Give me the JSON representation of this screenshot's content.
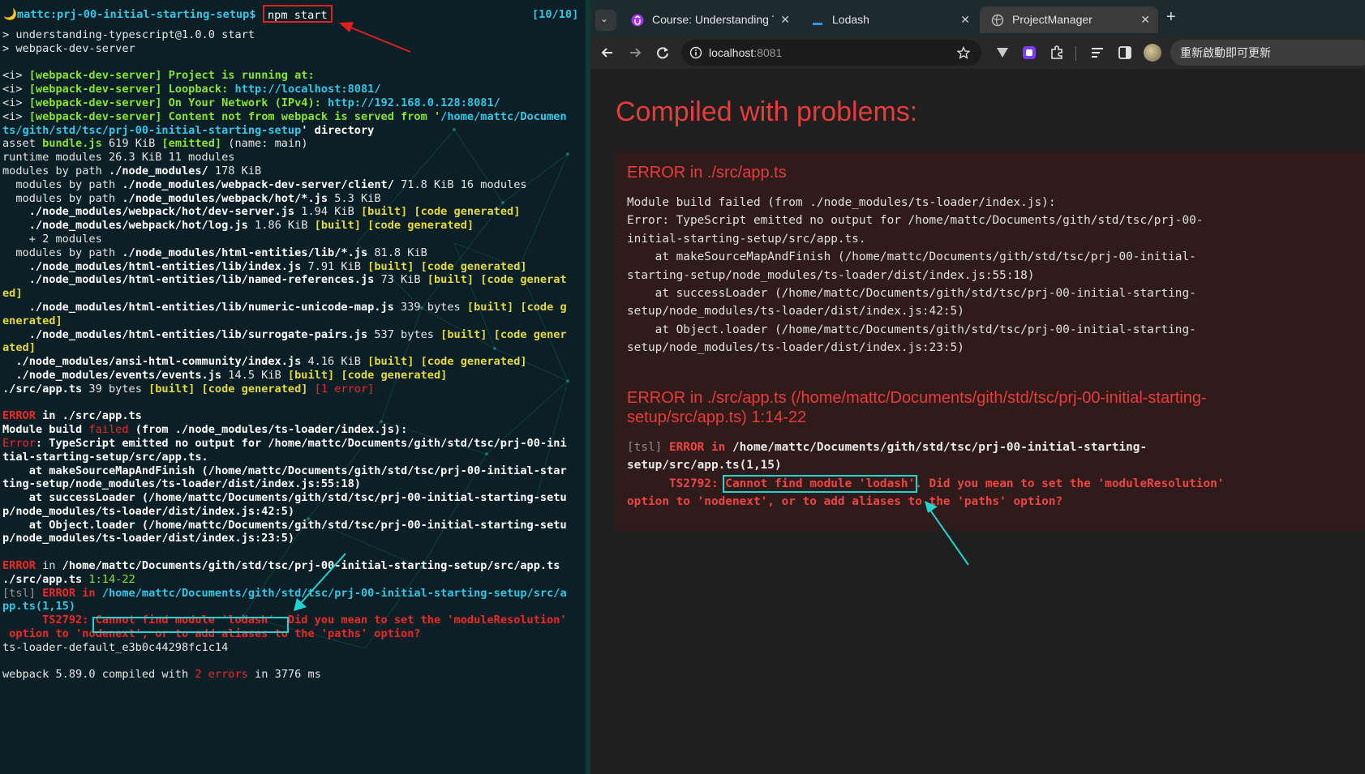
{
  "terminal": {
    "prompt_host": "🌙mattc:prj-00-initial-starting-setup$",
    "command": "npm start",
    "counter": "[10/10]",
    "lines": [
      [
        [
          "> understanding-typescript@1.0.0 start",
          "w"
        ]
      ],
      [
        [
          "> webpack-dev-server",
          "w"
        ]
      ],
      [
        [
          "",
          ""
        ]
      ],
      [
        [
          "<i> ",
          "w"
        ],
        [
          "[webpack-dev-server] Project is running at:",
          "g"
        ]
      ],
      [
        [
          "<i> ",
          "w"
        ],
        [
          "[webpack-dev-server] Loopback: ",
          "g"
        ],
        [
          "http://localhost:8081/",
          "c"
        ]
      ],
      [
        [
          "<i> ",
          "w"
        ],
        [
          "[webpack-dev-server] On Your Network (IPv4): ",
          "g"
        ],
        [
          "http://192.168.0.128:8081/",
          "c"
        ]
      ],
      [
        [
          "<i> ",
          "w"
        ],
        [
          "[webpack-dev-server] Content not from webpack is served from '",
          "g"
        ],
        [
          "/home/mattc/Documen",
          "c"
        ]
      ],
      [
        [
          "ts/gith/std/tsc/prj-00-initial-starting-setup",
          "c"
        ],
        [
          "' directory",
          "wb"
        ]
      ],
      [
        [
          "asset ",
          "w"
        ],
        [
          "bundle.js",
          "g"
        ],
        [
          " 619 KiB ",
          "w"
        ],
        [
          "[emitted]",
          "g"
        ],
        [
          " (name: main)",
          "w"
        ]
      ],
      [
        [
          "runtime modules 26.3 KiB 11 modules",
          "w"
        ]
      ],
      [
        [
          "modules by path ",
          "w"
        ],
        [
          "./node_modules/",
          "wb"
        ],
        [
          " 178 KiB",
          "w"
        ]
      ],
      [
        [
          "  modules by path ",
          "w"
        ],
        [
          "./node_modules/webpack-dev-server/client/",
          "wb"
        ],
        [
          " 71.8 KiB 16 modules",
          "w"
        ]
      ],
      [
        [
          "  modules by path ",
          "w"
        ],
        [
          "./node_modules/webpack/hot/*.js",
          "wb"
        ],
        [
          " 5.3 KiB",
          "w"
        ]
      ],
      [
        [
          "    ./node_modules/webpack/hot/dev-server.js",
          "wb"
        ],
        [
          " 1.94 KiB ",
          "w"
        ],
        [
          "[built] [code generated]",
          "y"
        ]
      ],
      [
        [
          "    ./node_modules/webpack/hot/log.js",
          "wb"
        ],
        [
          " 1.86 KiB ",
          "w"
        ],
        [
          "[built] [code generated]",
          "y"
        ]
      ],
      [
        [
          "    + 2 modules",
          "w"
        ]
      ],
      [
        [
          "  modules by path ",
          "w"
        ],
        [
          "./node_modules/html-entities/lib/*.js",
          "wb"
        ],
        [
          " 81.8 KiB",
          "w"
        ]
      ],
      [
        [
          "    ./node_modules/html-entities/lib/index.js",
          "wb"
        ],
        [
          " 7.91 KiB ",
          "w"
        ],
        [
          "[built] [code generated]",
          "y"
        ]
      ],
      [
        [
          "    ./node_modules/html-entities/lib/named-references.js",
          "wb"
        ],
        [
          " 73 KiB ",
          "w"
        ],
        [
          "[built] [code generat",
          "y"
        ]
      ],
      [
        [
          "ed]",
          "y"
        ]
      ],
      [
        [
          "    ./node_modules/html-entities/lib/numeric-unicode-map.js",
          "wb"
        ],
        [
          " 339 bytes ",
          "w"
        ],
        [
          "[built] [code g",
          "y"
        ]
      ],
      [
        [
          "enerated]",
          "y"
        ]
      ],
      [
        [
          "    ./node_modules/html-entities/lib/surrogate-pairs.js",
          "wb"
        ],
        [
          " 537 bytes ",
          "w"
        ],
        [
          "[built] [code gener",
          "y"
        ]
      ],
      [
        [
          "ated]",
          "y"
        ]
      ],
      [
        [
          "  ./node_modules/ansi-html-community/index.js",
          "wb"
        ],
        [
          " 4.16 KiB ",
          "w"
        ],
        [
          "[built] [code generated]",
          "y"
        ]
      ],
      [
        [
          "  ./node_modules/events/events.js",
          "wb"
        ],
        [
          " 14.5 KiB ",
          "w"
        ],
        [
          "[built] [code generated]",
          "y"
        ]
      ],
      [
        [
          "./src/app.ts",
          "wb"
        ],
        [
          " 39 bytes ",
          "w"
        ],
        [
          "[built] [code generated] ",
          "y"
        ],
        [
          "[1 error]",
          "r2"
        ]
      ],
      [
        [
          "",
          ""
        ]
      ],
      [
        [
          "ERROR",
          "r"
        ],
        [
          " in ./src/app.ts",
          "wb"
        ]
      ],
      [
        [
          "Module build ",
          "wb"
        ],
        [
          "failed",
          "r2"
        ],
        [
          " (from ./node_modules/ts-loader/index.js):",
          "wb"
        ]
      ],
      [
        [
          "Error",
          "r2"
        ],
        [
          ": TypeScript emitted no output for /home/mattc/Documents/gith/std/tsc/prj-00-ini",
          "wb"
        ]
      ],
      [
        [
          "tial-starting-setup/src/app.ts.",
          "wb"
        ]
      ],
      [
        [
          "    at makeSourceMapAndFinish (/home/mattc/Documents/gith/std/tsc/prj-00-initial-star",
          "wb"
        ]
      ],
      [
        [
          "ting-setup/node_modules/ts-loader/dist/index.js:55:18)",
          "wb"
        ]
      ],
      [
        [
          "    at successLoader (/home/mattc/Documents/gith/std/tsc/prj-00-initial-starting-setu",
          "wb"
        ]
      ],
      [
        [
          "p/node_modules/ts-loader/dist/index.js:42:5)",
          "wb"
        ]
      ],
      [
        [
          "    at Object.loader (/home/mattc/Documents/gith/std/tsc/prj-00-initial-starting-setu",
          "wb"
        ]
      ],
      [
        [
          "p/node_modules/ts-loader/dist/index.js:23:5)",
          "wb"
        ]
      ],
      [
        [
          "",
          ""
        ]
      ],
      [
        [
          "ERROR",
          "r"
        ],
        [
          " in ",
          "w"
        ],
        [
          "/home/mattc/Documents/gith/std/tsc/prj-00-initial-starting-setup/src/app.ts",
          "wb"
        ]
      ],
      [
        [
          "./src/app.ts ",
          "wb"
        ],
        [
          "1:14-22",
          "gy"
        ]
      ],
      [
        [
          "[tsl] ",
          "gr"
        ],
        [
          "ERROR",
          "r"
        ],
        [
          " in ",
          "r"
        ],
        [
          "/home/mattc/Documents/gith/std/tsc/prj-00-initial-starting-setup/src/a",
          "c"
        ]
      ],
      [
        [
          "pp.ts(1,15)",
          "c"
        ]
      ],
      [
        [
          "      TS2792: ",
          "r"
        ],
        [
          "Cannot find module 'lodash'",
          "r"
        ],
        [
          "  Did you mean to set the 'moduleResolution'",
          "r"
        ]
      ],
      [
        [
          " option to 'nodenext', or to add aliases to the 'paths' option?",
          "r"
        ]
      ],
      [
        [
          "ts-loader-default_e3b0c44298fc1c14",
          "w"
        ]
      ],
      [
        [
          "",
          ""
        ]
      ],
      [
        [
          "webpack 5.89.0 compiled with ",
          "w"
        ],
        [
          "2 errors",
          "r2"
        ],
        [
          " in 3776 ms",
          "w"
        ]
      ]
    ]
  },
  "browser": {
    "tabs": [
      {
        "title": "Course: Understanding T",
        "close": "✕"
      },
      {
        "title": "Lodash",
        "close": "✕"
      },
      {
        "title": "ProjectManager",
        "close": "✕"
      }
    ],
    "new_tab": "+",
    "url_host": "localhost",
    "url_port": ":8081",
    "relaunch": "重新啟動即可更新",
    "overlay": {
      "title": "Compiled with problems:",
      "error1_heading": "ERROR in ./src/app.ts",
      "error1_body": "Module build failed (from ./node_modules/ts-loader/index.js):\nError: TypeScript emitted no output for /home/mattc/Documents/gith/std/tsc/prj-00-\ninitial-starting-setup/src/app.ts.\n    at makeSourceMapAndFinish (/home/mattc/Documents/gith/std/tsc/prj-00-initial-\nstarting-setup/node_modules/ts-loader/dist/index.js:55:18)\n    at successLoader (/home/mattc/Documents/gith/std/tsc/prj-00-initial-starting-\nsetup/node_modules/ts-loader/dist/index.js:42:5)\n    at Object.loader (/home/mattc/Documents/gith/std/tsc/prj-00-initial-starting-\nsetup/node_modules/ts-loader/dist/index.js:23:5)",
      "error2_heading_l1": "ERROR in ./src/app.ts (/home/mattc/Documents/gith/std/tsc/prj-00-initial-starting-",
      "error2_heading_l2": "setup/src/app.ts) 1:14-22",
      "tsl_prefix": "[tsl] ",
      "tsl_error": "ERROR in ",
      "tsl_path_l1": "/home/mattc/Documents/gith/std/tsc/prj-00-initial-starting-",
      "tsl_path_l2": "setup/src/app.ts(1,15)",
      "ts_code": "      TS2792: ",
      "ts_msg": "Cannot find module 'lodash'",
      "ts_rest_l1": ". Did you mean to set the 'moduleResolution'",
      "ts_rest_l2": "option to 'nodenext', or to add aliases to the 'paths' option?"
    }
  },
  "colors": {
    "accent_red": "#e0201c",
    "annotation_cyan": "#22d3d3",
    "overlay_red": "#e83b3b"
  },
  "icons": [
    "moon-icon",
    "course-favicon-icon",
    "lodash-favicon-icon",
    "globe-icon",
    "back-icon",
    "forward-icon",
    "reload-icon",
    "info-icon",
    "star-icon",
    "extension-icon",
    "puzzle-icon",
    "reading-list-icon",
    "side-panel-icon",
    "avatar",
    "chevron-down-icon"
  ]
}
